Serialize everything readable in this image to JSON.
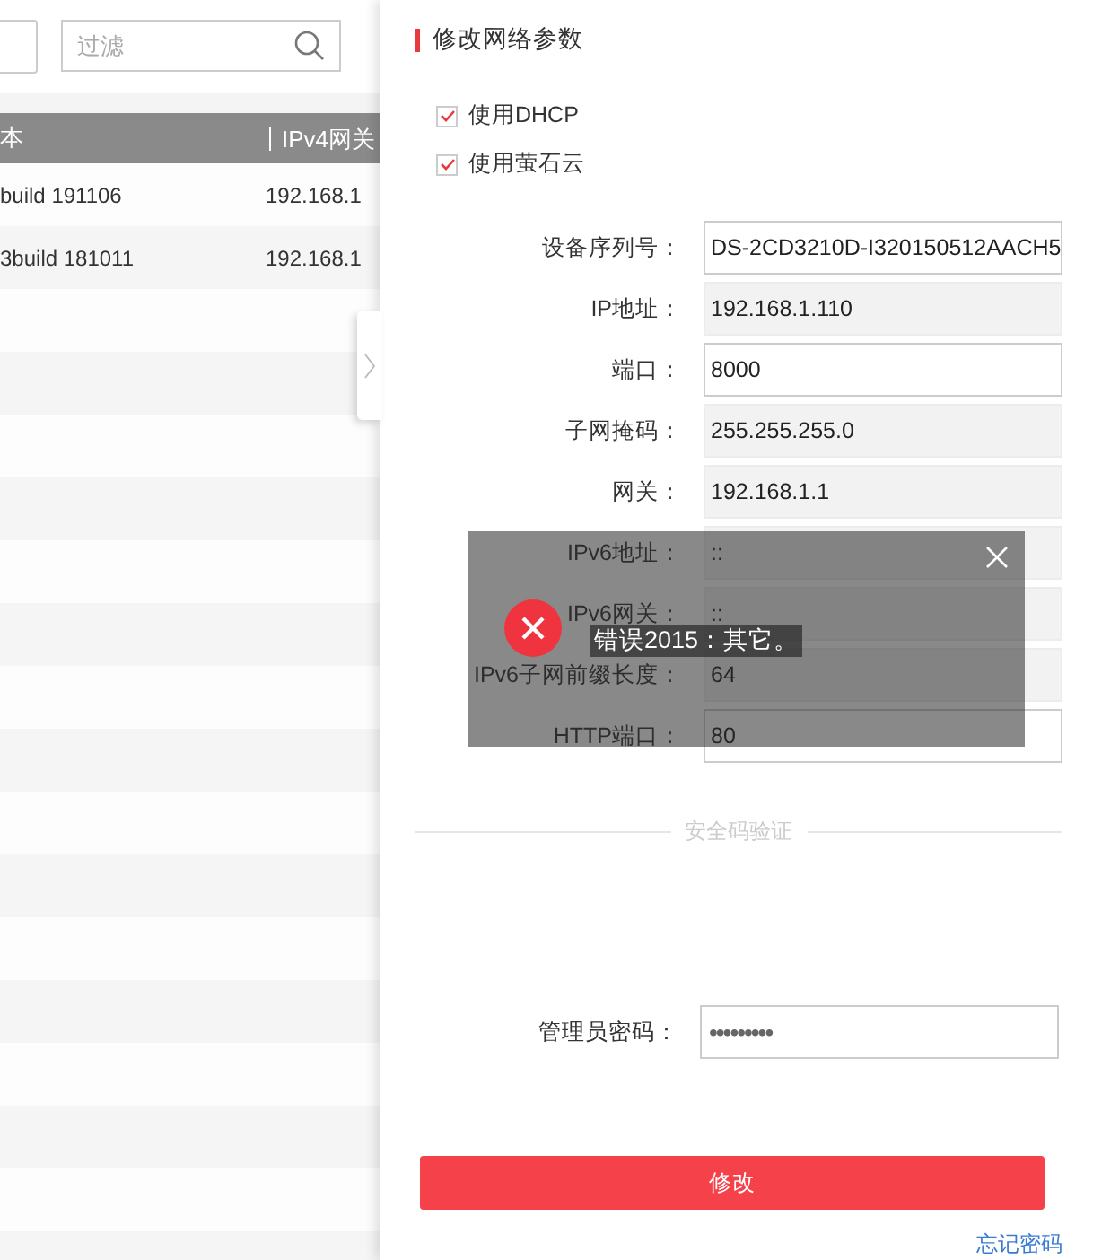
{
  "left": {
    "filter": {
      "placeholder": "过滤"
    },
    "table": {
      "columns": [
        "本",
        "IPv4网关"
      ],
      "rows": [
        [
          "build 191106",
          "192.168.1"
        ],
        [
          "3build 181011",
          "192.168.1"
        ]
      ]
    }
  },
  "panel": {
    "title": "修改网络参数",
    "checkboxes": [
      {
        "label": "使用DHCP",
        "checked": true
      },
      {
        "label": "使用萤石云",
        "checked": true
      }
    ],
    "fields": [
      {
        "label": "设备序列号：",
        "value": "DS-2CD3210D-I320150512AACH5",
        "editable": true
      },
      {
        "label": "IP地址：",
        "value": "192.168.1.110",
        "editable": false
      },
      {
        "label": "端口：",
        "value": "8000",
        "editable": true
      },
      {
        "label": "子网掩码：",
        "value": "255.255.255.0",
        "editable": false
      },
      {
        "label": "网关：",
        "value": "192.168.1.1",
        "editable": false
      },
      {
        "label": "IPv6地址：",
        "value": "::",
        "editable": false
      },
      {
        "label": "IPv6网关：",
        "value": "::",
        "editable": false
      },
      {
        "label": "IPv6子网前缀长度：",
        "value": "64",
        "editable": false
      },
      {
        "label": "HTTP端口：",
        "value": "80",
        "editable": true
      }
    ],
    "section_title": "安全码验证",
    "password": {
      "label": "管理员密码：",
      "value": "•••••••••"
    },
    "submit": "修改",
    "forgot_link": "忘记密码"
  },
  "toast": {
    "message": "错误2015：其它。"
  }
}
